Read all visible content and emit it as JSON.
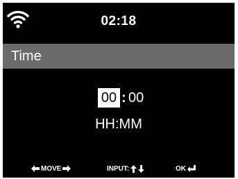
{
  "status": {
    "time": "02:18",
    "wifi_icon": "wifi-icon"
  },
  "title": "Time",
  "time_edit": {
    "hours": "00",
    "separator": ":",
    "minutes": "00",
    "format": "HH:MM"
  },
  "hints": {
    "move_label": "MOVE",
    "input_label": "INPUT:",
    "ok_label": "OK"
  },
  "colors": {
    "screen_bg": "#000000",
    "title_bar": "#6b6b6b",
    "text": "#ffffff",
    "highlight_bg": "#ffffff"
  }
}
